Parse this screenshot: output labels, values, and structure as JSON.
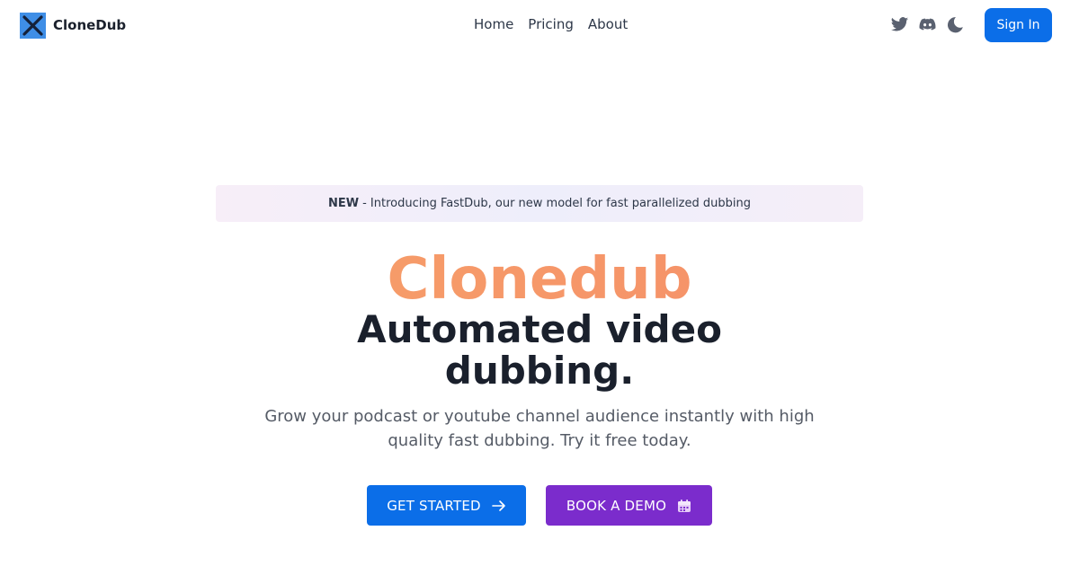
{
  "brand": {
    "name": "CloneDub"
  },
  "nav": {
    "links": [
      "Home",
      "Pricing",
      "About"
    ]
  },
  "header": {
    "icons": [
      "twitter-icon",
      "discord-icon",
      "moon-icon"
    ],
    "signin_label": "Sign In"
  },
  "announcement": {
    "tag": "NEW",
    "text": "- Introducing FastDub, our new model for fast parallelized dubbing"
  },
  "hero": {
    "brand_word": "Clonedub",
    "title": "Automated video dubbing.",
    "subtitle": "Grow your podcast or youtube channel audience instantly with high quality fast dubbing. Try it free today."
  },
  "cta": {
    "primary_label": "GET STARTED",
    "secondary_label": "BOOK A DEMO"
  },
  "colors": {
    "primary": "#0b6ee8",
    "secondary": "#7b2ccc",
    "brand_gradient_start": "#f6a56a",
    "brand_gradient_end": "#f58a68",
    "text_dark": "#1a202c",
    "text_muted": "#555b66"
  }
}
